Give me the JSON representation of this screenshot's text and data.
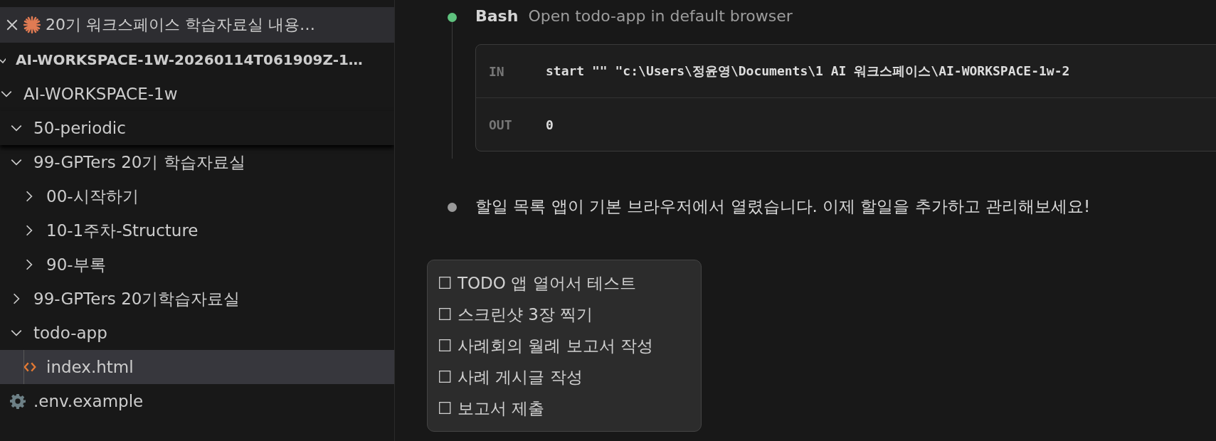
{
  "sidebar": {
    "tab": {
      "title": "20기 워크스페이스 학습자료실 내용…"
    },
    "workspace": {
      "title": "AI-WORKSPACE-1W-20260114T061909Z-1…"
    },
    "tree": [
      {
        "label": "AI-WORKSPACE-1w",
        "kind": "folder",
        "expanded": true,
        "selected": false,
        "children": [
          {
            "label": "50-periodic",
            "kind": "folder",
            "expanded": true,
            "selected": false,
            "sticky": true
          },
          {
            "label": "99-GPTers 20기 학습자료실",
            "kind": "folder",
            "expanded": true,
            "selected": false,
            "children": [
              {
                "label": "00-시작하기",
                "kind": "folder",
                "expanded": false,
                "selected": false
              },
              {
                "label": "10-1주차-Structure",
                "kind": "folder",
                "expanded": false,
                "selected": false
              },
              {
                "label": "90-부록",
                "kind": "folder",
                "expanded": false,
                "selected": false
              }
            ]
          },
          {
            "label": "99-GPTers 20기학습자료실",
            "kind": "folder",
            "expanded": false,
            "selected": false
          },
          {
            "label": "todo-app",
            "kind": "folder",
            "expanded": true,
            "selected": false,
            "children": [
              {
                "label": "index.html",
                "kind": "html-file",
                "selected": true
              }
            ]
          },
          {
            "label": ".env.example",
            "kind": "config-file",
            "selected": false
          }
        ]
      }
    ]
  },
  "chat": {
    "entries": [
      {
        "kind": "tool",
        "color": "#5fc27e",
        "tool": "Bash",
        "description": "Open todo-app in default browser",
        "io": [
          {
            "label": "IN",
            "value": "start \"\" \"c:\\Users\\정윤영\\Documents\\1 AI 워크스페이스\\AI-WORKSPACE-1w-2"
          },
          {
            "label": "OUT",
            "value": "0"
          }
        ]
      },
      {
        "kind": "text",
        "color": "#9a9a9a",
        "text": "할일 목록 앱이 기본 브라우저에서 열렸습니다. 이제 할일을 추가하고 관리해보세요!"
      }
    ],
    "checklist": [
      "☐ TODO 앱 열어서 테스트",
      "☐ 스크린샷 3장 찍기",
      "☐ 사례회의 월례 보고서 작성",
      "☐ 사례 게시글 작성",
      "☐ 보고서 제출"
    ]
  }
}
